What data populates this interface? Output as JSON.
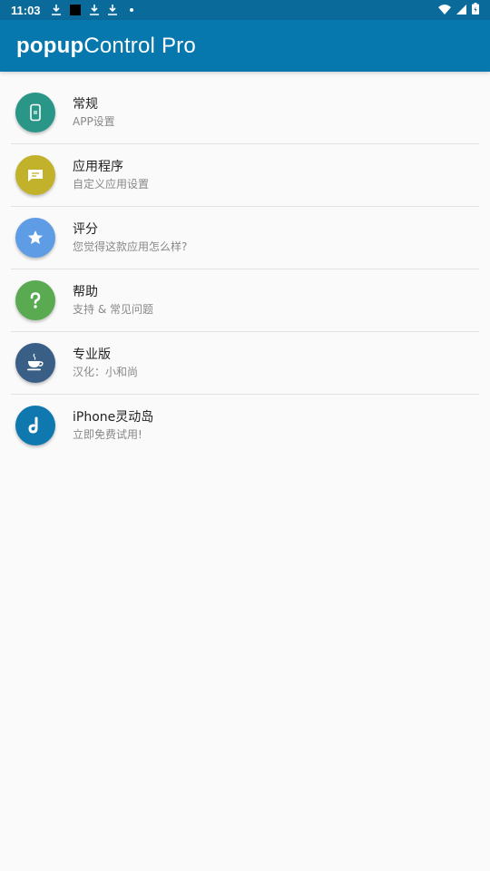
{
  "status_bar": {
    "time": "11:03"
  },
  "app_bar": {
    "title_bold": "popup",
    "title_rest": "Control Pro",
    "background": "#0778ae"
  },
  "items": [
    {
      "title": "常规",
      "subtitle": "APP设置",
      "icon": "phone-icon",
      "color": "#2a9688"
    },
    {
      "title": "应用程序",
      "subtitle": "自定义应用设置",
      "icon": "message-icon",
      "color": "#c2b12a"
    },
    {
      "title": "评分",
      "subtitle": "您觉得这款应用怎么样?",
      "icon": "star-icon",
      "color": "#5f9ce6"
    },
    {
      "title": "帮助",
      "subtitle": "支持 & 常见问题",
      "icon": "help-icon",
      "color": "#5aaa52"
    },
    {
      "title": "专业版",
      "subtitle": "汉化：小和尚",
      "icon": "coffee-icon",
      "color": "#3a5f86"
    },
    {
      "title": "iPhone灵动岛",
      "subtitle": "立即免费试用!",
      "icon": "tiktok-icon",
      "color": "#0f78ae"
    }
  ]
}
